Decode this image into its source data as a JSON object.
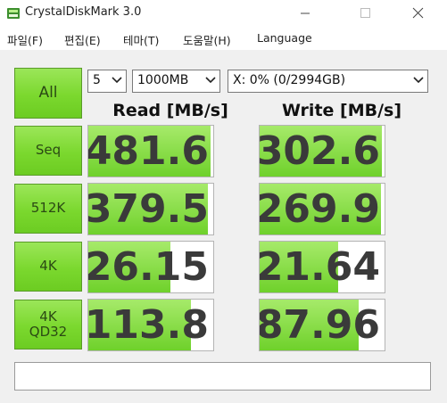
{
  "window": {
    "title": "CrystalDiskMark 3.0",
    "icons": [
      "app-disk-icon",
      "minimize-icon",
      "maximize-icon",
      "close-icon"
    ]
  },
  "menu": {
    "items": [
      "파일(F)",
      "편집(E)",
      "테마(T)",
      "도움말(H)",
      "Language"
    ]
  },
  "controls": {
    "all_label": "All",
    "runs": "5",
    "size": "1000MB",
    "drive": "X: 0% (0/2994GB)"
  },
  "headers": {
    "read": "Read [MB/s]",
    "write": "Write [MB/s]"
  },
  "rows": [
    {
      "label": "Seq",
      "label2": "",
      "read": "481.6",
      "write": "302.6",
      "read_fill": 0.98,
      "write_fill": 0.98
    },
    {
      "label": "512K",
      "label2": "",
      "read": "379.5",
      "write": "269.9",
      "read_fill": 0.96,
      "write_fill": 0.97
    },
    {
      "label": "4K",
      "label2": "",
      "read": "26.15",
      "write": "21.64",
      "read_fill": 0.66,
      "write_fill": 0.63
    },
    {
      "label": "4K",
      "label2": "QD32",
      "read": "113.8",
      "write": "87.96",
      "read_fill": 0.82,
      "write_fill": 0.79
    }
  ],
  "colors": {
    "button_green": "#7bd82e",
    "bar_green": "#6fd12b",
    "background": "#f0f0f0"
  },
  "status": ""
}
